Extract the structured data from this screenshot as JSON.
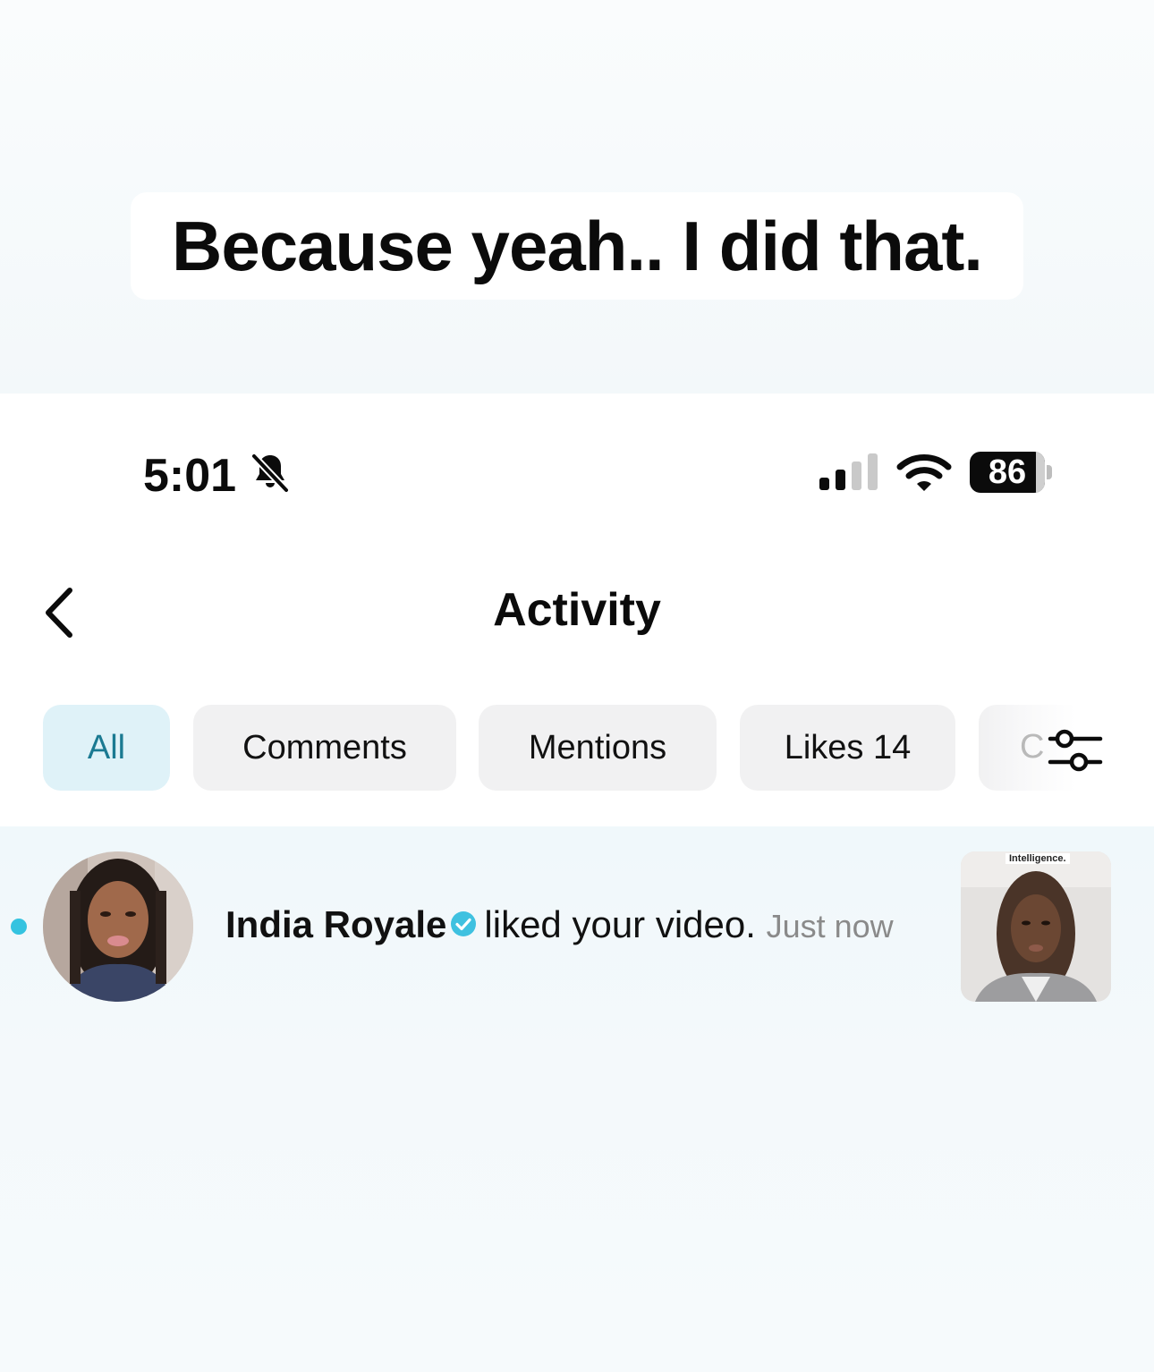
{
  "caption": {
    "text": "Because yeah.. I did that."
  },
  "status_bar": {
    "time": "5:01",
    "silent_icon": "bell-slash-icon",
    "signal_icon": "cellular-signal-icon",
    "signal_bars_active": 2,
    "signal_bars_total": 4,
    "wifi_icon": "wifi-icon",
    "battery_level": "86"
  },
  "header": {
    "back_icon": "chevron-left-icon",
    "title": "Activity"
  },
  "tabs": [
    {
      "label": "All",
      "active": true
    },
    {
      "label": "Comments",
      "active": false
    },
    {
      "label": "Mentions",
      "active": false
    },
    {
      "label": "Likes 14",
      "active": false
    },
    {
      "label": "C",
      "active": false,
      "partially_hidden": true
    }
  ],
  "filter": {
    "icon": "sliders-icon"
  },
  "notifications": [
    {
      "unread": true,
      "user": "India Royale",
      "verified": true,
      "action": "liked your video.",
      "time": "Just now",
      "thumbnail_text": "Intelligence."
    }
  ],
  "colors": {
    "accent": "#35c3e0",
    "active_tab_bg": "#dff2f8",
    "active_tab_text": "#1b7a92",
    "tab_bg": "#f1f1f2",
    "verified_badge": "#3fc1e0"
  }
}
